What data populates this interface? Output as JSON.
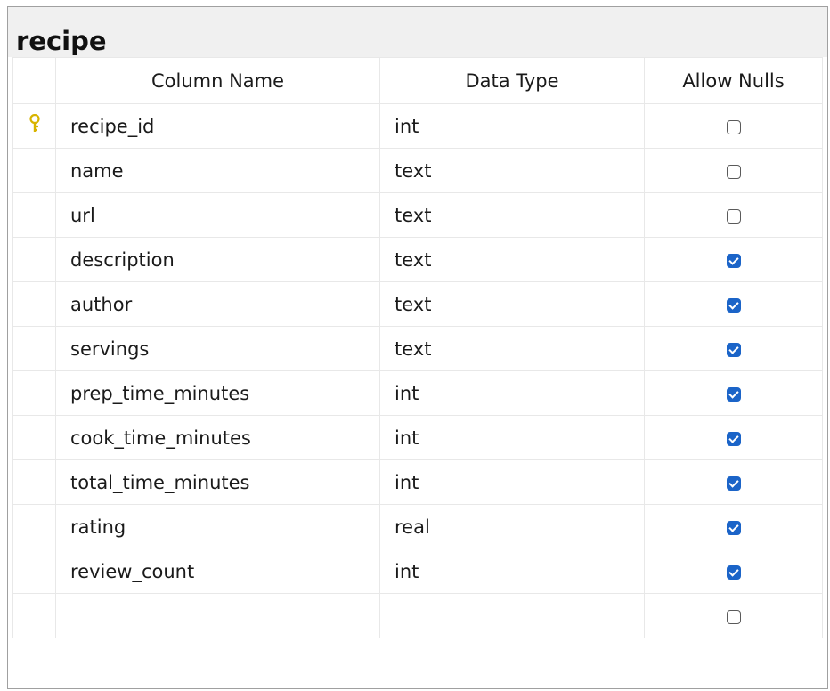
{
  "table": {
    "title": "recipe",
    "headers": {
      "column_name": "Column Name",
      "data_type": "Data Type",
      "allow_nulls": "Allow Nulls"
    },
    "rows": [
      {
        "name": "recipe_id",
        "type": "int",
        "allow_nulls": false,
        "primary_key": true,
        "icon": "key-icon"
      },
      {
        "name": "name",
        "type": "text",
        "allow_nulls": false
      },
      {
        "name": "url",
        "type": "text",
        "allow_nulls": false
      },
      {
        "name": "description",
        "type": "text",
        "allow_nulls": true
      },
      {
        "name": "author",
        "type": "text",
        "allow_nulls": true
      },
      {
        "name": "servings",
        "type": "text",
        "allow_nulls": true
      },
      {
        "name": "prep_time_minutes",
        "type": "int",
        "allow_nulls": true
      },
      {
        "name": "cook_time_minutes",
        "type": "int",
        "allow_nulls": true
      },
      {
        "name": "total_time_minutes",
        "type": "int",
        "allow_nulls": true
      },
      {
        "name": "rating",
        "type": "real",
        "allow_nulls": true
      },
      {
        "name": "review_count",
        "type": "int",
        "allow_nulls": true
      },
      {
        "name": "",
        "type": "",
        "allow_nulls": false
      }
    ]
  },
  "colors": {
    "title_bar": "#f0f0f0",
    "checkbox_checked": "#1b64c8",
    "key_icon": "#d8b400"
  }
}
